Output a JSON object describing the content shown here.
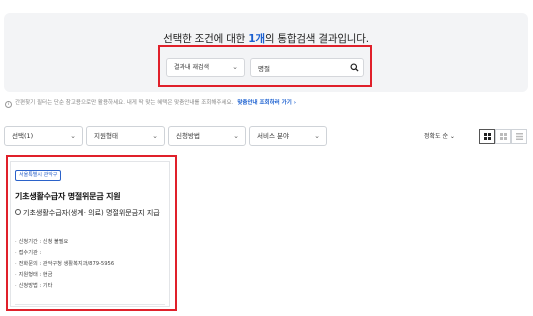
{
  "search": {
    "headline_before": "선택한 조건에 대한 ",
    "headline_count": "1개",
    "headline_after": "의 통합검색 결과입니다.",
    "scope_label": "결과내 재검색",
    "query_value": "명절"
  },
  "notice": {
    "text": "간편찾기 필터는 단순 참고용으로만 활용하세요. 내게 딱 맞는 혜택은 맞춤안내를 조회해주세요.",
    "link_text": "맞춤안내 조회하러 가기",
    "link_arrow": "›"
  },
  "filters": [
    {
      "label": "선택(1)"
    },
    {
      "label": "지원형태"
    },
    {
      "label": "신청방법"
    },
    {
      "label": "서비스 분야"
    }
  ],
  "sort": {
    "label": "정확도 순",
    "arrow": "⌄"
  },
  "card": {
    "tag": "서울특별시 관악구",
    "title": "기초생활수급자 명절위문금 지원",
    "description": "기초생활수급자(생계· 의료) 명절위문금지 지급",
    "details": [
      "신청기간 : 신청 불필요",
      "접수기관 :",
      "전화문의 : 관악구청 생활복지과/879-5956",
      "지원형태 : 현금",
      "신청방법 : 기타"
    ]
  },
  "colors": {
    "accent": "#1a5fd0",
    "highlight_border": "#e0202a",
    "panel_bg": "#f3f4f6"
  }
}
